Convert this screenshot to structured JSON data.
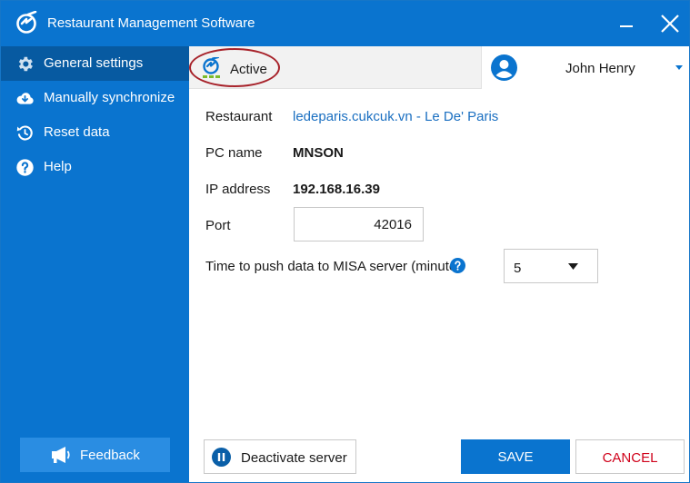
{
  "app": {
    "title": "Restaurant Management Software",
    "logo_icon": "misa-logo-icon",
    "accent_color": "#0a74cf"
  },
  "window_controls": {
    "minimize_icon": "minimize-icon",
    "close_icon": "close-icon"
  },
  "sidebar": {
    "items": [
      {
        "label": "General settings",
        "icon": "gear-icon",
        "active": true
      },
      {
        "label": "Manually synchronize",
        "icon": "cloud-download-icon",
        "active": false
      },
      {
        "label": "Reset data",
        "icon": "reset-icon",
        "active": false
      },
      {
        "label": "Help",
        "icon": "question-icon",
        "active": false
      }
    ],
    "feedback_label": "Feedback",
    "feedback_icon": "megaphone-icon"
  },
  "topbar": {
    "status_label": "Active",
    "status_icon": "sync-status-icon",
    "user_name": "John Henry",
    "user_icon": "user-avatar-icon"
  },
  "form": {
    "restaurant_label": "Restaurant",
    "restaurant_value": "ledeparis.cukcuk.vn - Le De' Paris",
    "pc_name_label": "PC name",
    "pc_name_value": "MNSON",
    "ip_label": "IP address",
    "ip_value": "192.168.16.39",
    "port_label": "Port",
    "port_value": "42016",
    "push_label": "Time to push data to MISA server (minute)",
    "push_value": "5"
  },
  "footer": {
    "deactivate_label": "Deactivate server",
    "save_label": "SAVE",
    "cancel_label": "CANCEL",
    "cancel_color": "#d0021b"
  }
}
